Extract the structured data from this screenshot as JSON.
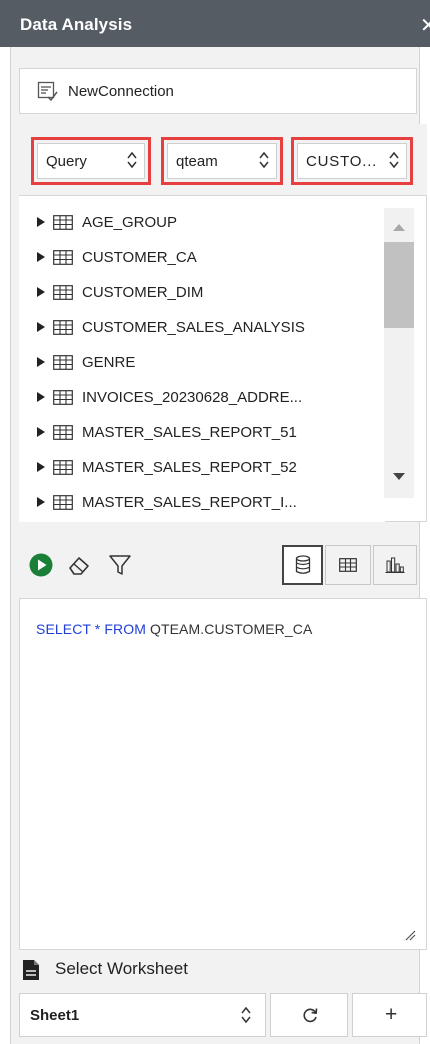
{
  "header": {
    "title": "Data Analysis",
    "close_icon": "close-icon"
  },
  "connection": {
    "label": "NewConnection",
    "icon": "connection-list-icon"
  },
  "selectors": {
    "mode": "Query",
    "schema": "qteam",
    "table": "CUSTO..."
  },
  "tables": [
    {
      "label": "AGE_GROUP"
    },
    {
      "label": "CUSTOMER_CA"
    },
    {
      "label": "CUSTOMER_DIM"
    },
    {
      "label": "CUSTOMER_SALES_ANALYSIS"
    },
    {
      "label": "GENRE"
    },
    {
      "label": "INVOICES_20230628_ADDRE..."
    },
    {
      "label": "MASTER_SALES_REPORT_51"
    },
    {
      "label": "MASTER_SALES_REPORT_52"
    },
    {
      "label": "MASTER_SALES_REPORT_I..."
    }
  ],
  "toolbar": {
    "run_icon": "play-icon",
    "clear_icon": "eraser-icon",
    "filter_icon": "filter-icon",
    "view_database_icon": "database-icon",
    "view_table_icon": "table-icon",
    "view_chart_icon": "bar-chart-icon"
  },
  "editor": {
    "kw_select": "SELECT",
    "star": " * ",
    "kw_from": "FROM",
    "target": " QTEAM.CUSTOMER_CA"
  },
  "worksheet": {
    "label": "Select Worksheet",
    "selected": "Sheet1",
    "refresh_icon": "refresh-icon",
    "add_label": "+"
  },
  "colors": {
    "header_bg": "#555c63",
    "highlight_border": "#e53f3f",
    "run_button": "#1a7f37",
    "sql_keyword": "#1f3fd6"
  }
}
